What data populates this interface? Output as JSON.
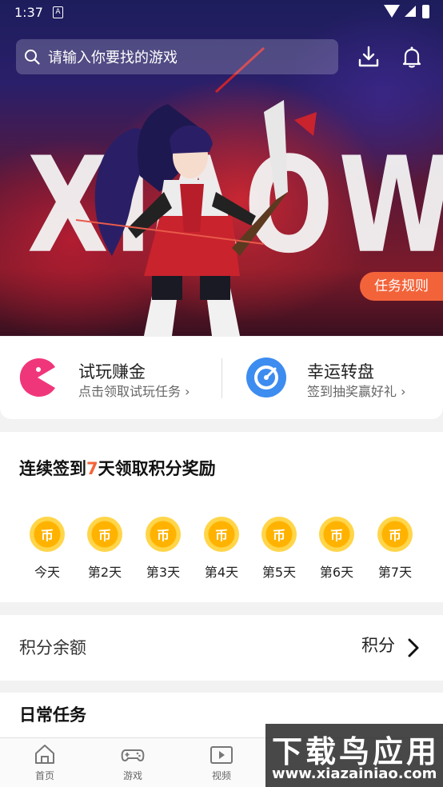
{
  "status_bar": {
    "time": "1:37",
    "indicator": "A"
  },
  "search": {
    "placeholder": "请输入你要找的游戏"
  },
  "hero": {
    "banner_text": "XIAOWAN",
    "rules_label": "任务规则"
  },
  "quick_actions": [
    {
      "title": "试玩赚金",
      "subtitle": "点击领取试玩任务 ›",
      "icon": "pacman-icon",
      "color": "#f0367a"
    },
    {
      "title": "幸运转盘",
      "subtitle": "签到抽奖赢好礼 ›",
      "icon": "dial-icon",
      "color": "#3d8cf0"
    }
  ],
  "signin": {
    "title_prefix": "连续签到",
    "title_highlight": "7",
    "title_suffix": "天领取积分奖励",
    "coin_glyph": "币",
    "days": [
      "今天",
      "第2天",
      "第3天",
      "第4天",
      "第5天",
      "第6天",
      "第7天"
    ]
  },
  "balance": {
    "label": "积分余额",
    "value": "积分"
  },
  "daily": {
    "title": "日常任务"
  },
  "nav": [
    {
      "label": "首页",
      "icon": "home-icon"
    },
    {
      "label": "游戏",
      "icon": "gamepad-icon"
    },
    {
      "label": "视频",
      "icon": "video-icon"
    }
  ],
  "watermark": {
    "main": "下载鸟应用",
    "sub": "www.xiazainiao.com"
  },
  "colors": {
    "accent": "#f3633a",
    "coin": "#ffc107"
  }
}
